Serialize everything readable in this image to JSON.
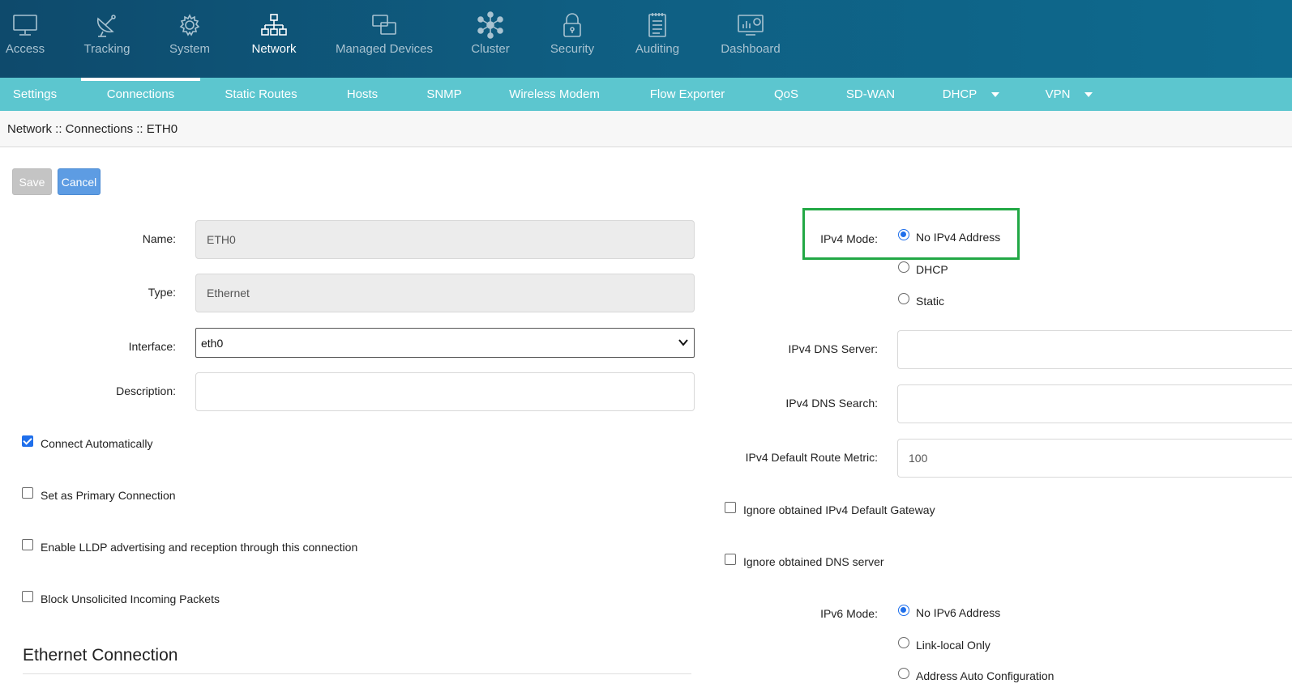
{
  "topnav": {
    "items": [
      {
        "label": "Access",
        "icon": "monitor-icon"
      },
      {
        "label": "Tracking",
        "icon": "satellite-dish-icon"
      },
      {
        "label": "System",
        "icon": "gear-icon"
      },
      {
        "label": "Network",
        "icon": "network-icon",
        "active": true
      },
      {
        "label": "Managed Devices",
        "icon": "devices-icon"
      },
      {
        "label": "Cluster",
        "icon": "cluster-icon"
      },
      {
        "label": "Security",
        "icon": "lock-icon"
      },
      {
        "label": "Auditing",
        "icon": "notepad-icon"
      },
      {
        "label": "Dashboard",
        "icon": "dashboard-icon"
      }
    ]
  },
  "subnav": {
    "items": [
      {
        "label": "Settings"
      },
      {
        "label": "Connections",
        "active": true
      },
      {
        "label": "Static Routes"
      },
      {
        "label": "Hosts"
      },
      {
        "label": "SNMP"
      },
      {
        "label": "Wireless Modem"
      },
      {
        "label": "Flow Exporter"
      },
      {
        "label": "QoS"
      },
      {
        "label": "SD-WAN"
      },
      {
        "label": "DHCP",
        "dropdown": true
      },
      {
        "label": "VPN",
        "dropdown": true
      }
    ]
  },
  "breadcrumb": "Network :: Connections :: ETH0",
  "buttons": {
    "save": "Save",
    "cancel": "Cancel"
  },
  "form": {
    "name_label": "Name:",
    "name_value": "ETH0",
    "type_label": "Type:",
    "type_value": "Ethernet",
    "interface_label": "Interface:",
    "interface_value": "eth0",
    "description_label": "Description:",
    "description_value": "",
    "connect_automatically": {
      "label": "Connect Automatically",
      "checked": true
    },
    "primary_connection": {
      "label": "Set as Primary Connection",
      "checked": false
    },
    "lldp": {
      "label": "Enable LLDP advertising and reception through this connection",
      "checked": false
    },
    "block_unsolicited": {
      "label": "Block Unsolicited Incoming Packets",
      "checked": false
    },
    "ethernet_section_title": "Ethernet Connection"
  },
  "ipv4": {
    "mode_label": "IPv4 Mode:",
    "modes": [
      {
        "label": "No IPv4 Address",
        "selected": true
      },
      {
        "label": "DHCP",
        "selected": false
      },
      {
        "label": "Static",
        "selected": false
      }
    ],
    "dns_server_label": "IPv4 DNS Server:",
    "dns_server_value": "",
    "dns_search_label": "IPv4 DNS Search:",
    "dns_search_value": "",
    "route_metric_label": "IPv4 Default Route Metric:",
    "route_metric_value": "100",
    "ignore_gateway": {
      "label": "Ignore obtained IPv4 Default Gateway",
      "checked": false
    },
    "ignore_dns": {
      "label": "Ignore obtained DNS server",
      "checked": false
    }
  },
  "ipv6": {
    "mode_label": "IPv6 Mode:",
    "modes": [
      {
        "label": "No IPv6 Address",
        "selected": true
      },
      {
        "label": "Link-local Only",
        "selected": false
      },
      {
        "label": "Address Auto Configuration",
        "selected": false
      }
    ]
  },
  "colors": {
    "topnav_bg": "#0f5e82",
    "subnav_bg": "#5cc6cf",
    "highlight": "#22a845",
    "accent": "#1f6feb"
  }
}
